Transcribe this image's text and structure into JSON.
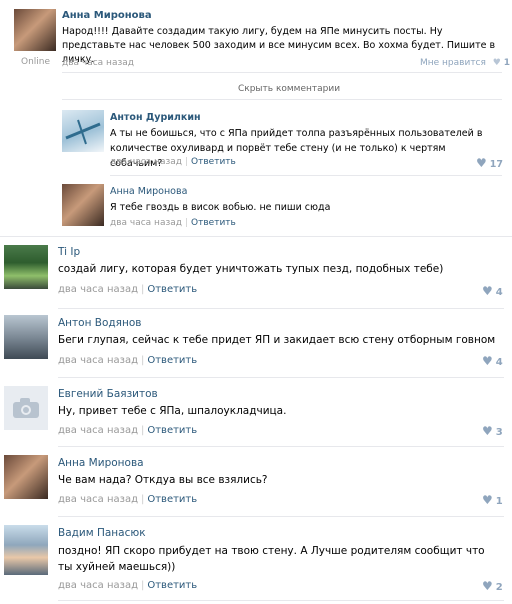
{
  "post": {
    "author": "Анна Миронова",
    "text": "Народ!!!! Давайте создадим такую лигу, будем на ЯПе минусить посты. Ну представьте нас человек 500 заходим и все минусим всех. Во хохма будет. Пишите в личку.",
    "online": "Online",
    "time": "два часа назад",
    "like_label": "Мне нравится",
    "like_count": "1"
  },
  "hide_comments": "Скрыть комментарии",
  "nested": [
    {
      "author": "Антон Дурилкин",
      "text": "А ты не боишься, что с ЯПа прийдет толпа разъярённых пользователей в количестве охуливард и порвёт тебе стену (и не только) к чертям собачьим?",
      "time": "два часа назад",
      "reply": "Ответить",
      "likes": "17"
    },
    {
      "author": "Анна Миронова",
      "text": "Я тебе гвоздь в висок вобью. не пиши сюда",
      "time": "два часа назад",
      "reply": "Ответить",
      "likes": ""
    }
  ],
  "comments": [
    {
      "author": "Ti Ip",
      "text": "создай лигу, которая будет уничтожать тупых пезд, подобных тебе)",
      "time": "два часа назад",
      "reply": "Ответить",
      "likes": "4"
    },
    {
      "author": "Антон Водянов",
      "text": "Беги глупая, сейчас к тебе придет ЯП и закидает всю стену отборным говном",
      "time": "два часа назад",
      "reply": "Ответить",
      "likes": "4"
    },
    {
      "author": "Евгений Баязитов",
      "text": "Ну, привет тебе с ЯПа, шпалоукладчица.",
      "time": "два часа назад",
      "reply": "Ответить",
      "likes": "3"
    },
    {
      "author": "Анна Миронова",
      "text": "Че вам нада? Откдуа вы все взялись?",
      "time": "два часа назад",
      "reply": "Ответить",
      "likes": "1"
    },
    {
      "author": "Вадим Панасюк",
      "text": "поздно! ЯП скоро прибудет на твою стену. А Лучше родителям сообщит что ты хуйней маешься))",
      "time": "два часа назад",
      "reply": "Ответить",
      "likes": "2"
    }
  ]
}
